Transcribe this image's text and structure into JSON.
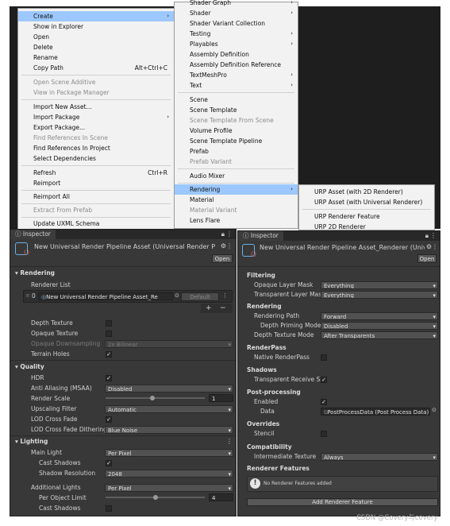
{
  "menu1": {
    "items": [
      {
        "label": "Create",
        "arrow": "›",
        "highlight": true
      },
      {
        "label": "Show in Explorer"
      },
      {
        "label": "Open"
      },
      {
        "label": "Delete"
      },
      {
        "label": "Rename"
      },
      {
        "label": "Copy Path",
        "shortcut": "Alt+Ctrl+C"
      },
      {
        "label": "Open Scene Additive",
        "disabled": true
      },
      {
        "label": "View in Package Manager",
        "disabled": true
      },
      {
        "label": "Import New Asset..."
      },
      {
        "label": "Import Package",
        "arrow": "›"
      },
      {
        "label": "Export Package..."
      },
      {
        "label": "Find References In Scene",
        "disabled": true
      },
      {
        "label": "Find References In Project"
      },
      {
        "label": "Select Dependencies"
      },
      {
        "label": "Refresh",
        "shortcut": "Ctrl+R"
      },
      {
        "label": "Reimport"
      },
      {
        "label": "Reimport All"
      },
      {
        "label": "Extract From Prefab",
        "disabled": true
      },
      {
        "label": "Update UXML Schema"
      }
    ]
  },
  "menu2": {
    "items": [
      {
        "label": "Shader Graph",
        "arrow": "›"
      },
      {
        "label": "Shader",
        "arrow": "›"
      },
      {
        "label": "Shader Variant Collection"
      },
      {
        "label": "Testing",
        "arrow": "›"
      },
      {
        "label": "Playables",
        "arrow": "›"
      },
      {
        "label": "Assembly Definition"
      },
      {
        "label": "Assembly Definition Reference"
      },
      {
        "label": "TextMeshPro",
        "arrow": "›"
      },
      {
        "label": "Text",
        "arrow": "›"
      },
      {
        "label": "Scene"
      },
      {
        "label": "Scene Template"
      },
      {
        "label": "Scene Template From Scene",
        "disabled": true
      },
      {
        "label": "Volume Profile"
      },
      {
        "label": "Scene Template Pipeline"
      },
      {
        "label": "Prefab"
      },
      {
        "label": "Prefab Variant",
        "disabled": true
      },
      {
        "label": "Audio Mixer"
      },
      {
        "label": "Rendering",
        "arrow": "›",
        "highlight": true
      },
      {
        "label": "Material"
      },
      {
        "label": "Material Variant",
        "disabled": true
      },
      {
        "label": "Lens Flare"
      }
    ]
  },
  "menu3": {
    "items": [
      {
        "label": "URP Asset (with 2D Renderer)"
      },
      {
        "label": "URP Asset (with Universal Renderer)"
      },
      {
        "label": "URP Renderer Feature"
      },
      {
        "label": "URP 2D Renderer"
      }
    ]
  },
  "left": {
    "tab": "Inspector",
    "title": "New Universal Render Pipeline Asset (Universal Render P",
    "open": "Open",
    "rendering": "Rendering",
    "renderer_list": "Renderer List",
    "renderer_index": "0",
    "renderer_value": "New Universal Render Pipeline Asset_Re",
    "default_btn": "Default",
    "plus": "+",
    "minus": "−",
    "depth_texture": "Depth Texture",
    "opaque_texture": "Opaque Texture",
    "opaque_downsampling": "Opaque Downsampling",
    "opaque_downsampling_value": "2x Bilinear",
    "terrain_holes": "Terrain Holes",
    "quality": "Quality",
    "hdr": "HDR",
    "msaa": "Anti Aliasing (MSAA)",
    "msaa_value": "Disabled",
    "render_scale": "Render Scale",
    "render_scale_value": "1",
    "upscaling": "Upscaling Filter",
    "upscaling_value": "Automatic",
    "lod_fade": "LOD Cross Fade",
    "lod_dither": "LOD Cross Fade Dithering",
    "lod_dither_value": "Blue Noise",
    "lighting": "Lighting",
    "main_light": "Main Light",
    "main_light_value": "Per Pixel",
    "cast_shadows": "Cast Shadows",
    "shadow_res": "Shadow Resolution",
    "shadow_res_value": "2048",
    "additional_lights": "Additional Lights",
    "additional_lights_value": "Per Pixel",
    "per_object_limit": "Per Object Limit",
    "per_object_limit_value": "4",
    "cast_shadows2": "Cast Shadows"
  },
  "right": {
    "tab": "Inspector",
    "title": "New Universal Render Pipeline Asset_Renderer (Universa",
    "open": "Open",
    "filtering": "Filtering",
    "opaque_mask": "Opaque Layer Mask",
    "opaque_mask_value": "Everything",
    "transparent_mask": "Transparent Layer Mask",
    "transparent_mask_value": "Everything",
    "rendering": "Rendering",
    "rendering_path": "Rendering Path",
    "rendering_path_value": "Forward",
    "depth_priming": "Depth Priming Mode",
    "depth_priming_value": "Disabled",
    "depth_texture_mode": "Depth Texture Mode",
    "depth_texture_mode_value": "After Transparents",
    "renderpass": "RenderPass",
    "native_renderpass": "Native RenderPass",
    "shadows": "Shadows",
    "transparent_receive": "Transparent Receive Sha",
    "post_processing": "Post-processing",
    "enabled": "Enabled",
    "data": "Data",
    "data_value": "PostProcessData (Post Process Data)",
    "overrides": "Overrides",
    "stencil": "Stencil",
    "compatibility": "Compatibility",
    "intermediate_texture": "Intermediate Texture",
    "intermediate_texture_value": "Always",
    "renderer_features": "Renderer Features",
    "no_features": "No Renderer Features added",
    "add_feature": "Add Renderer Feature"
  },
  "watermark": "CSDN @Covery与covery"
}
